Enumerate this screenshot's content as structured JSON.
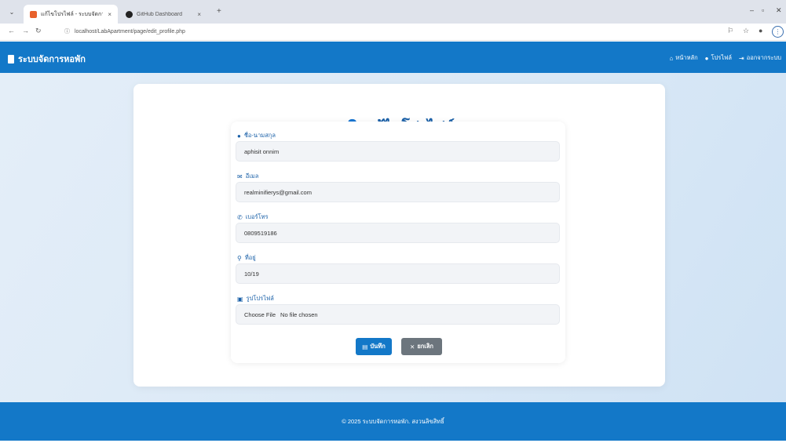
{
  "browser": {
    "tabs": [
      {
        "title": "แก้ไขโปรไฟล์ - ระบบจัดการหอพัก",
        "close": "×"
      },
      {
        "title": "GitHub Dashboard",
        "close": "×"
      }
    ],
    "new_tab": "+",
    "url_info": "ⓘ",
    "url": "localhost/LabApartment/page/edit_profile.php",
    "window_min": "–",
    "window_restore": "▫",
    "window_close": "✕"
  },
  "navbar": {
    "brand": "ระบบจัดการหอพัก",
    "links": {
      "home": "หน้าหลัก",
      "profile": "โปรไฟล์",
      "logout": "ออกจากระบบ"
    }
  },
  "form": {
    "title": "แก้ไขโปรไฟล์",
    "fields": {
      "name": {
        "label": "ชื่อ-นามสกุล",
        "value": "aphisit onnim"
      },
      "email": {
        "label": "อีเมล",
        "value": "realminifierys@gmail.com"
      },
      "phone": {
        "label": "เบอร์โทร",
        "value": "0809519186"
      },
      "address": {
        "label": "ที่อยู่",
        "value": "10/19"
      },
      "photo": {
        "label": "รูปโปรไฟล์",
        "button": "Choose File",
        "status": "No file chosen"
      }
    },
    "save_label": "บันทึก",
    "cancel_label": "ยกเลิก"
  },
  "footer": {
    "text": "© 2025 ระบบจัดการหอพัก. สงวนลิขสิทธิ์"
  },
  "colors": {
    "primary": "#1378c8",
    "secondary": "#6c757d",
    "title": "#1a60a8"
  }
}
